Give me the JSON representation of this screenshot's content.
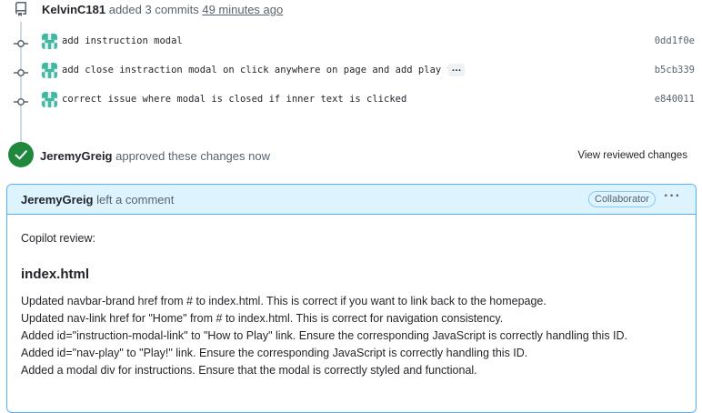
{
  "push": {
    "author": "KelvinC181",
    "action": "added 3 commits",
    "time": "49 minutes ago"
  },
  "commits": [
    {
      "message": "add instruction modal",
      "sha": "0dd1f0e",
      "has_ellipsis": false
    },
    {
      "message": "add close instraction modal on click anywhere on page and add play fu…",
      "sha": "b5cb339",
      "has_ellipsis": true
    },
    {
      "message": "correct issue where modal is closed if inner text is clicked",
      "sha": "e840011",
      "has_ellipsis": false
    }
  ],
  "ellipsis_label": "…",
  "approval": {
    "author": "JeremyGreig",
    "text": "approved these changes now",
    "view_label": "View reviewed changes"
  },
  "comment": {
    "author": "JeremyGreig",
    "action": "left a comment",
    "badge": "Collaborator",
    "menu_label": "···",
    "intro": "Copilot review:",
    "file": "index.html",
    "lines": [
      "Updated navbar-brand href from # to index.html. This is correct if you want to link back to the homepage.",
      "Updated nav-link href for \"Home\" from # to index.html. This is correct for navigation consistency.",
      "Added id=\"instruction-modal-link\" to \"How to Play\" link. Ensure the corresponding JavaScript is correctly handling this ID.",
      "Added id=\"nav-play\" to \"Play!\" link. Ensure the corresponding JavaScript is correctly handling this ID.",
      "Added a modal div for instructions. Ensure that the modal is correctly styled and functional."
    ]
  },
  "colors": {
    "approved": "#1f883d",
    "link": "#0969da",
    "comment_header_bg": "#ddf4ff",
    "comment_border": "#54aeff",
    "avatar": "#3fb9a3"
  },
  "icons": {
    "push": "repo-push-icon",
    "commit": "git-commit-icon",
    "approved": "check-icon"
  }
}
